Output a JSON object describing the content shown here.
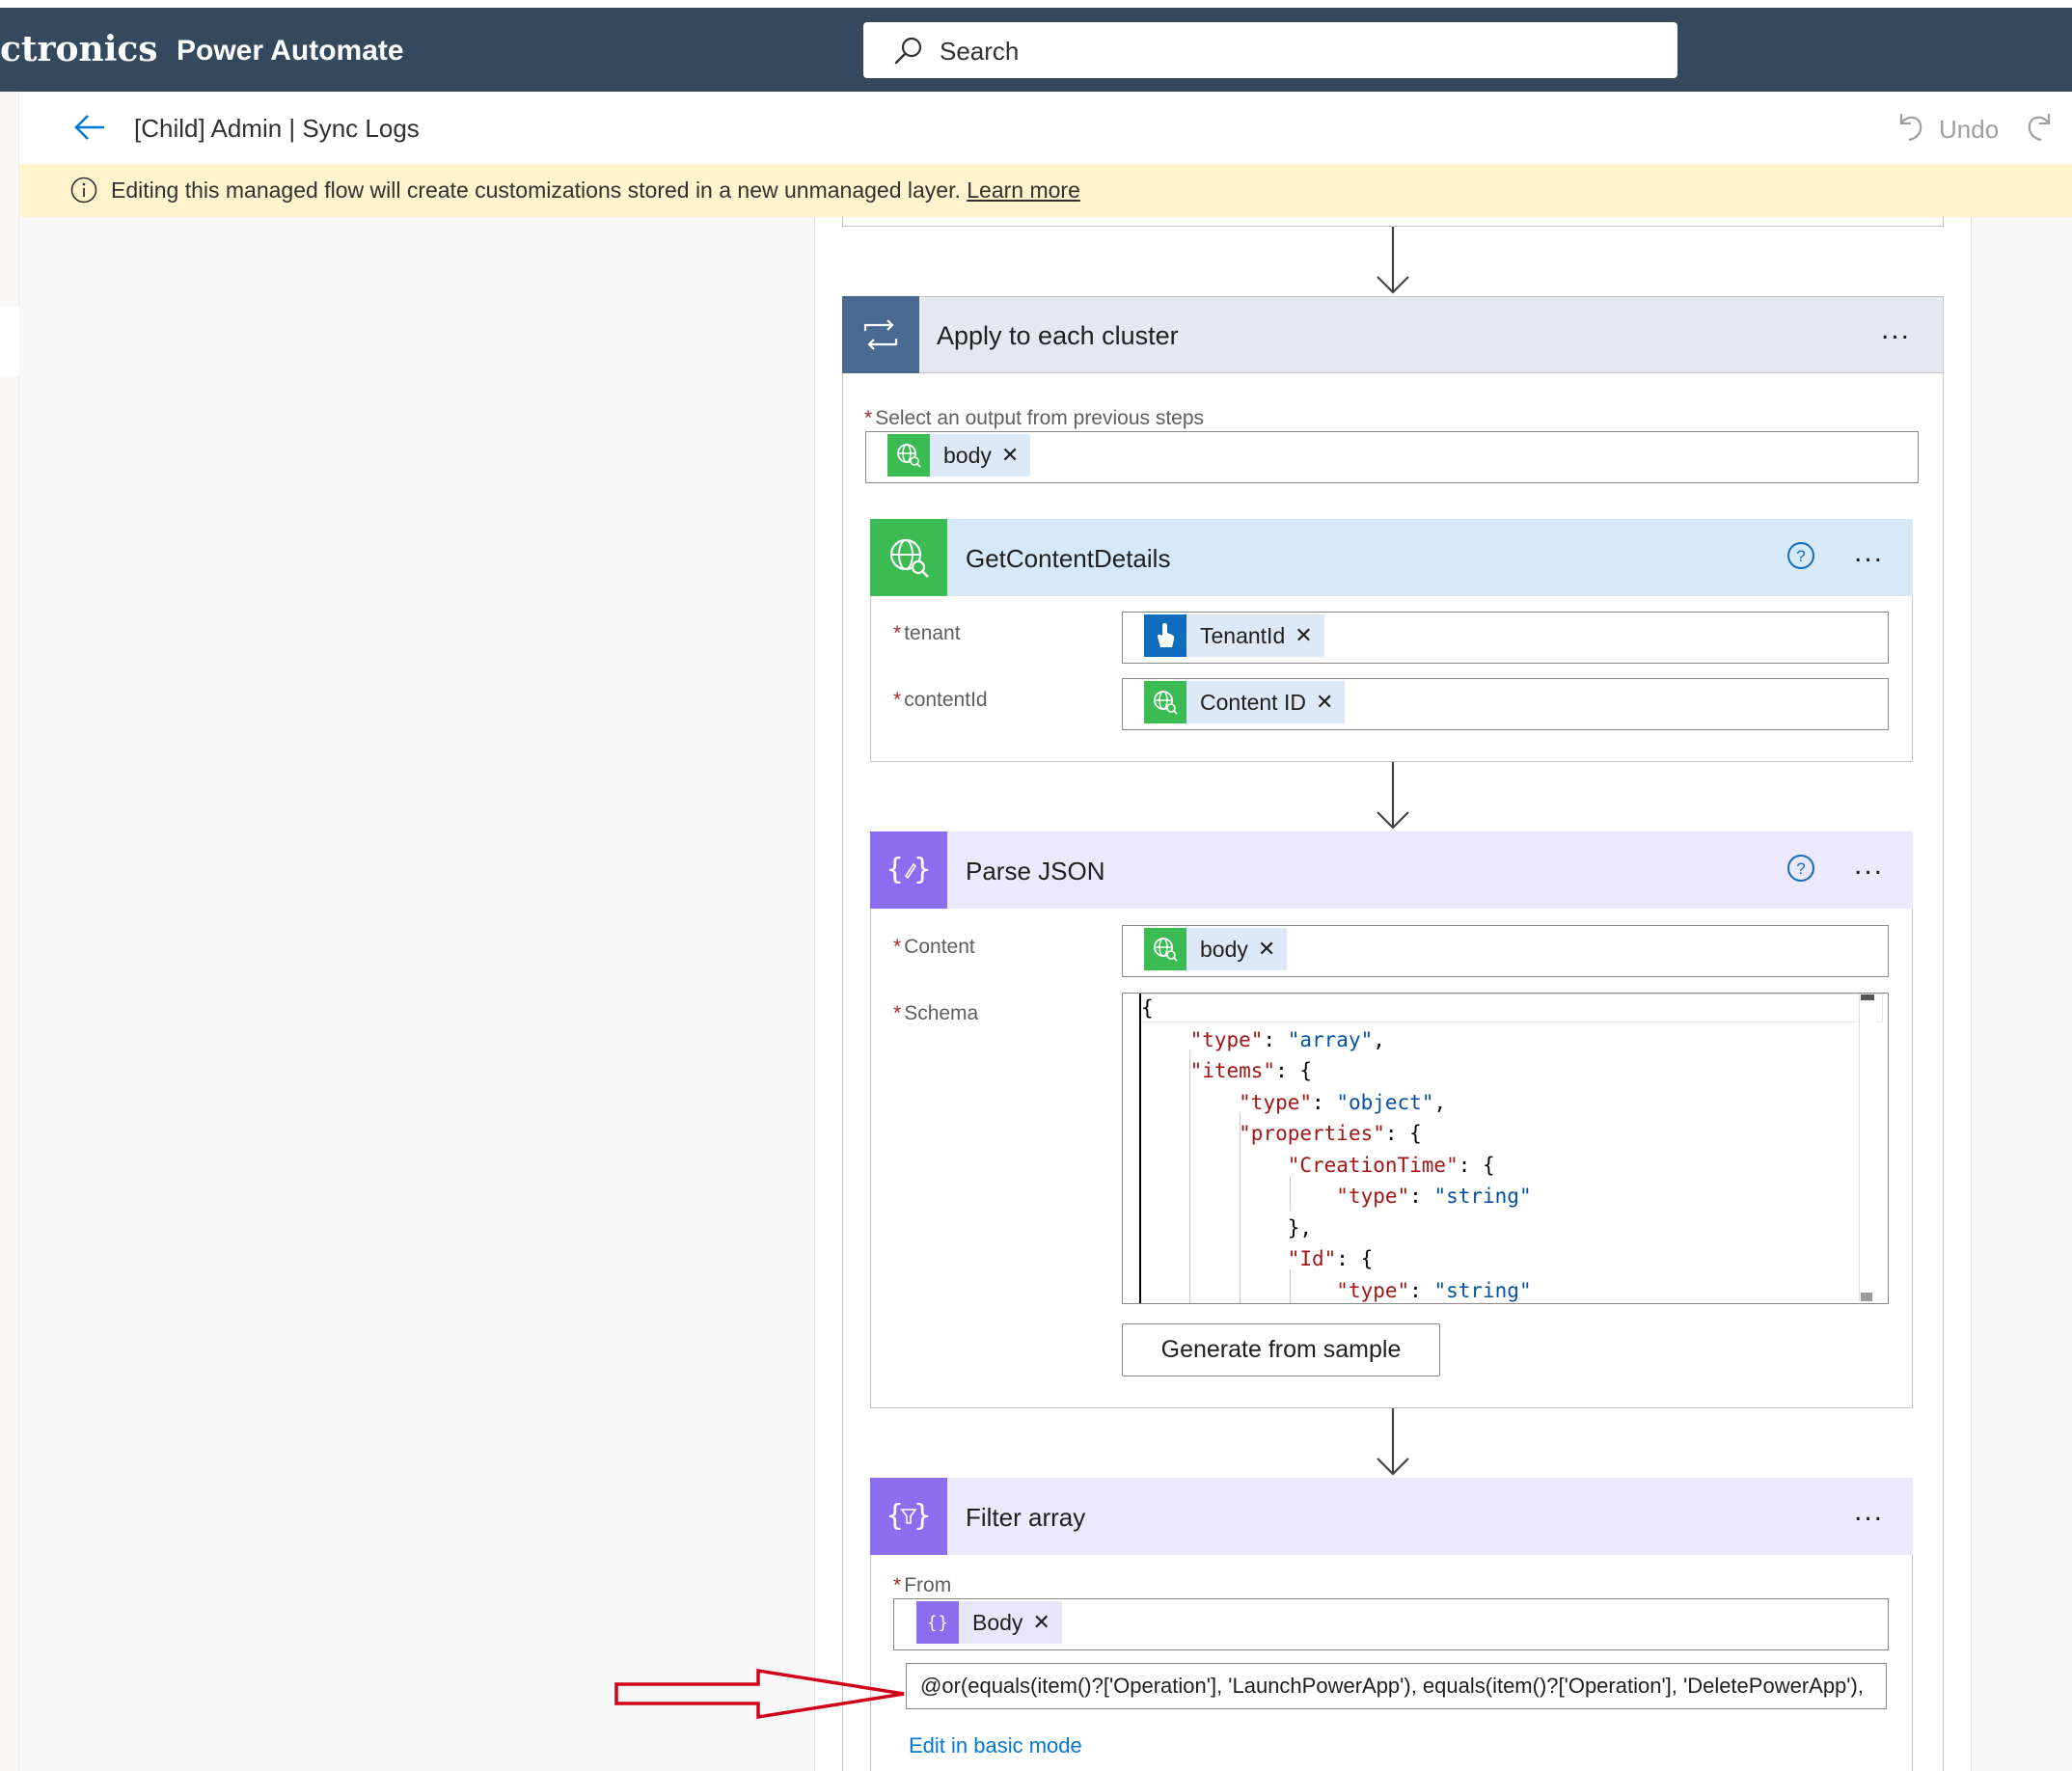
{
  "header": {
    "org_name": "ctronics",
    "app_title": "Power Automate",
    "search": {
      "placeholder": "Search"
    }
  },
  "command_bar": {
    "flow_title": "[Child] Admin | Sync Logs",
    "undo_label": "Undo"
  },
  "notice": {
    "text": "Editing this managed flow will create customizations stored in a new unmanaged layer.",
    "link_text": "Learn more"
  },
  "apply_to_each": {
    "title": "Apply to each cluster",
    "more": "...",
    "select_output_label": "Select an output from previous steps",
    "select_output_token": "body"
  },
  "get_content_details": {
    "title": "GetContentDetails",
    "more": "...",
    "fields": [
      {
        "label": "tenant",
        "token": "TenantId"
      },
      {
        "label": "contentId",
        "token": "Content ID"
      }
    ]
  },
  "parse_json": {
    "title": "Parse JSON",
    "more": "...",
    "content_label": "Content",
    "content_token": "body",
    "schema_label": "Schema",
    "schema_lines": [
      "{",
      "    \"type\": \"array\",",
      "    \"items\": {",
      "        \"type\": \"object\",",
      "        \"properties\": {",
      "            \"CreationTime\": {",
      "                \"type\": \"string\"",
      "            },",
      "            \"Id\": {",
      "                \"type\": \"string\""
    ],
    "generate_button": "Generate from sample"
  },
  "filter_array": {
    "title": "Filter array",
    "more": "...",
    "from_label": "From",
    "from_token": "Body",
    "expression": "@or(equals(item()?['Operation'], 'LaunchPowerApp'), equals(item()?['Operation'], 'DeletePowerApp'),",
    "edit_mode_link": "Edit in basic mode"
  },
  "colors": {
    "header_bg": "#35495e",
    "apply_icon_bg": "#486991",
    "http_icon_bg": "#3cba54",
    "connector_header_bg": "#d7e9f8",
    "data_ops_icon_bg": "#8c6cef",
    "data_ops_header_bg": "#ece8fd",
    "tenant_icon_bg": "#0f6cbd",
    "notice_bg": "#fff4ce",
    "annotation_arrow": "#d0021b"
  }
}
